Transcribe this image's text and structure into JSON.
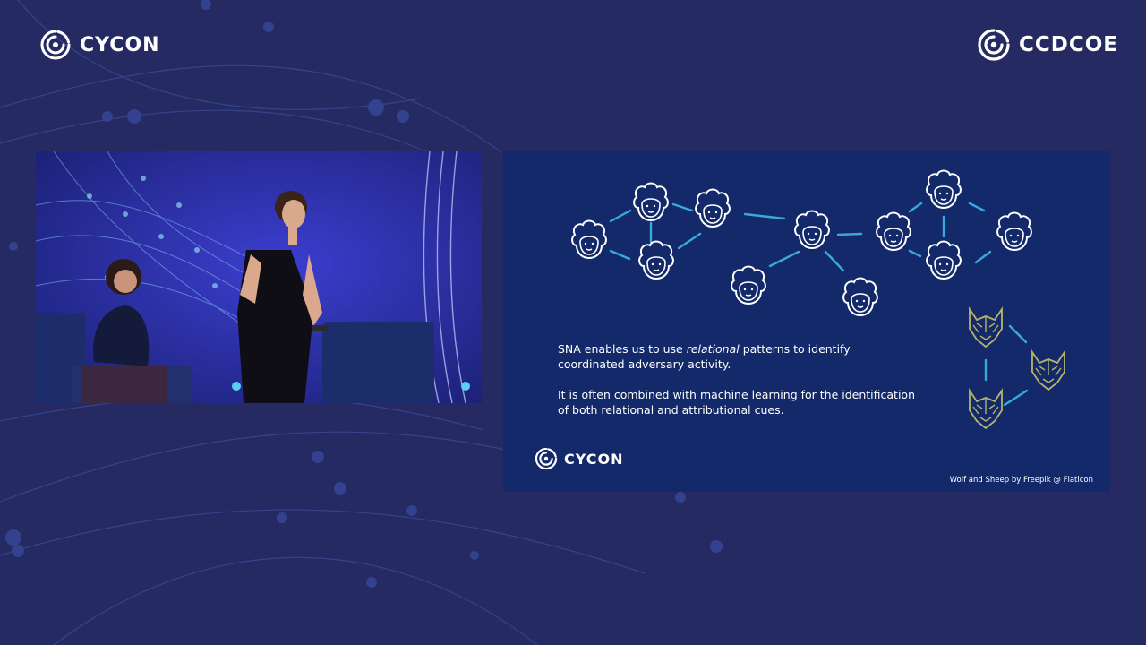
{
  "header": {
    "left_brand": "CYCON",
    "right_brand": "CCDCOE"
  },
  "slide": {
    "paragraph_1_before": "SNA enables us to use ",
    "paragraph_1_emph": "relational",
    "paragraph_1_after": " patterns to identify coordinated adversary activity.",
    "paragraph_2": "It is often combined with machine learning for the identification of both relational and attributional cues.",
    "logo_text": "CYCON",
    "credit": "Wolf and Sheep by Freepik @ Flaticon"
  },
  "icons": {
    "sheep": "sheep-icon",
    "wolf": "wolf-icon",
    "logo": "cycon-logo-icon"
  },
  "colors": {
    "background": "#262a63",
    "slide_background": "#13296a",
    "edge": "#37a9dd",
    "sheep_stroke": "#ffffff",
    "wolf_stroke": "#b7b46a"
  }
}
